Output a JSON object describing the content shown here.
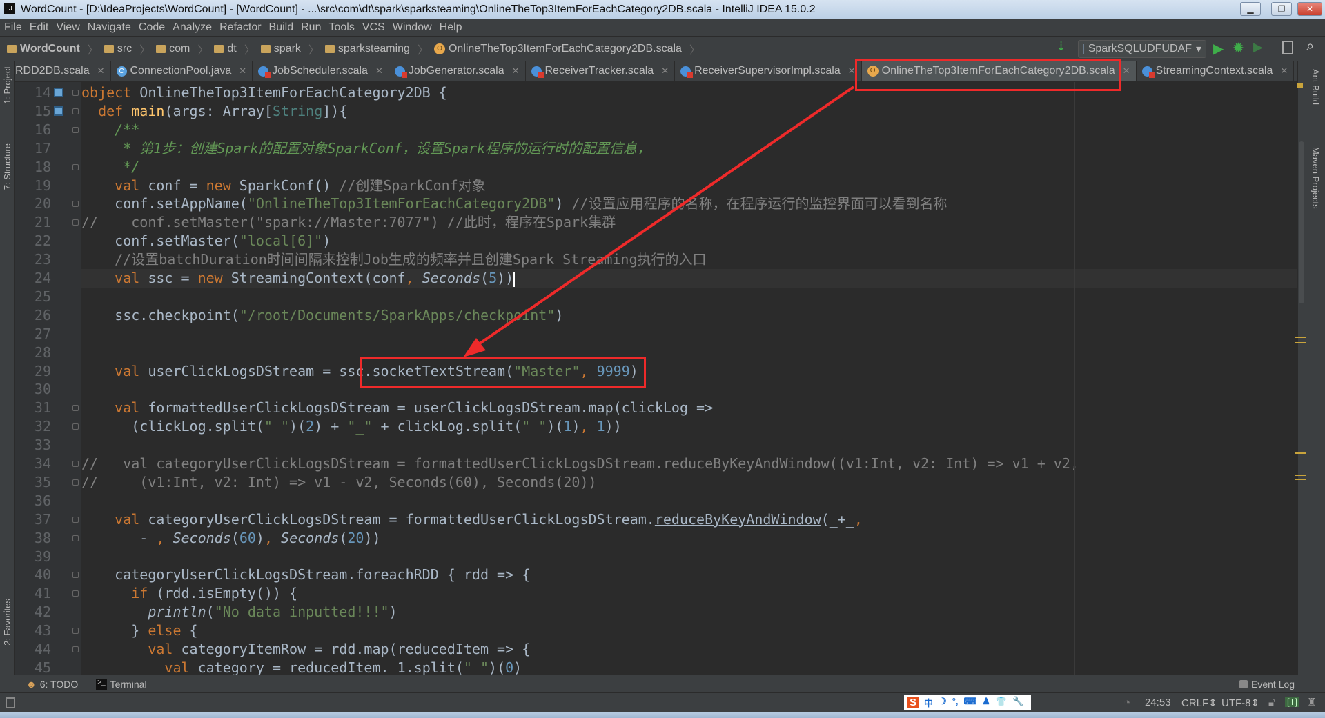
{
  "window": {
    "title": "WordCount - [D:\\IdeaProjects\\WordCount] - [WordCount] - ...\\src\\com\\dt\\spark\\sparksteaming\\OnlineTheTop3ItemForEachCategory2DB.scala - IntelliJ IDEA 15.0.2",
    "logo": "IJ"
  },
  "menu": [
    "File",
    "Edit",
    "View",
    "Navigate",
    "Code",
    "Analyze",
    "Refactor",
    "Build",
    "Run",
    "Tools",
    "VCS",
    "Window",
    "Help"
  ],
  "breadcrumb": [
    "WordCount",
    "src",
    "com",
    "dt",
    "spark",
    "sparksteaming",
    "OnlineTheTop3ItemForEachCategory2DB.scala"
  ],
  "toolbar": {
    "run_config": "SparkSQLUDFUDAF"
  },
  "tabs": [
    {
      "label": "RDD2DB.scala",
      "icon": "scala-class-icon"
    },
    {
      "label": "ConnectionPool.java",
      "icon": "java-class-icon"
    },
    {
      "label": "JobScheduler.scala",
      "icon": "scala-class-icon"
    },
    {
      "label": "JobGenerator.scala",
      "icon": "scala-class-icon"
    },
    {
      "label": "ReceiverTracker.scala",
      "icon": "scala-class-icon"
    },
    {
      "label": "ReceiverSupervisorImpl.scala",
      "icon": "scala-class-icon"
    },
    {
      "label": "OnlineTheTop3ItemForEachCategory2DB.scala",
      "icon": "scala-object-icon",
      "active": true
    },
    {
      "label": "StreamingContext.scala",
      "icon": "scala-class-icon"
    }
  ],
  "left_tools": [
    "1: Project",
    "7: Structure",
    "2: Favorites"
  ],
  "right_tools": [
    "Ant Build",
    "Maven Projects"
  ],
  "code": {
    "current_line": 24,
    "lines": [
      {
        "n": 14,
        "tokens": [
          [
            "k",
            "object"
          ],
          [
            "t",
            " OnlineTheTop3ItemForEachCategory2DB {"
          ]
        ]
      },
      {
        "n": 15,
        "tokens": [
          [
            "t",
            "  "
          ],
          [
            "k",
            "def"
          ],
          [
            "fn",
            " main"
          ],
          [
            "t",
            "(args: Array["
          ],
          [
            "ty",
            "String"
          ],
          [
            "t",
            "]){"
          ]
        ]
      },
      {
        "n": 16,
        "tokens": [
          [
            "t",
            "    "
          ],
          [
            "dc",
            "/**"
          ]
        ]
      },
      {
        "n": 17,
        "tokens": [
          [
            "dc",
            "     * 第1步：创建Spark的配置对象SparkConf，设置Spark程序的运行时的配置信息，"
          ]
        ]
      },
      {
        "n": 18,
        "tokens": [
          [
            "dc",
            "     */"
          ]
        ]
      },
      {
        "n": 19,
        "tokens": [
          [
            "t",
            "    "
          ],
          [
            "k",
            "val"
          ],
          [
            "t",
            " conf = "
          ],
          [
            "k",
            "new"
          ],
          [
            "t",
            " SparkConf() "
          ],
          [
            "c",
            "//创建SparkConf对象"
          ]
        ]
      },
      {
        "n": 20,
        "tokens": [
          [
            "t",
            "    conf.setAppName("
          ],
          [
            "s",
            "\"OnlineTheTop3ItemForEachCategory2DB\""
          ],
          [
            "t",
            ") "
          ],
          [
            "c",
            "//设置应用程序的名称，在程序运行的监控界面可以看到名称"
          ]
        ]
      },
      {
        "n": 21,
        "tokens": [
          [
            "c",
            "//    conf.setMaster(\"spark://Master:7077\") //此时，程序在Spark集群"
          ]
        ]
      },
      {
        "n": 22,
        "tokens": [
          [
            "t",
            "    conf.setMaster("
          ],
          [
            "s",
            "\"local[6]\""
          ],
          [
            "t",
            ")"
          ]
        ]
      },
      {
        "n": 23,
        "tokens": [
          [
            "c",
            "    //设置batchDuration时间间隔来控制Job生成的频率并且创建Spark Streaming执行的入口"
          ]
        ]
      },
      {
        "n": 24,
        "tokens": [
          [
            "t",
            "    "
          ],
          [
            "k",
            "val"
          ],
          [
            "t",
            " ssc = "
          ],
          [
            "k",
            "new"
          ],
          [
            "t",
            " StreamingContext(conf"
          ],
          [
            "k",
            ","
          ],
          [
            "t",
            " "
          ],
          [
            "i",
            "Seconds"
          ],
          [
            "t",
            "("
          ],
          [
            "n",
            "5"
          ],
          [
            "t",
            "))"
          ]
        ]
      },
      {
        "n": 25,
        "tokens": []
      },
      {
        "n": 26,
        "tokens": [
          [
            "t",
            "    ssc.checkpoint("
          ],
          [
            "s",
            "\"/root/Documents/SparkApps/checkpoint\""
          ],
          [
            "t",
            ")"
          ]
        ]
      },
      {
        "n": 27,
        "tokens": []
      },
      {
        "n": 28,
        "tokens": []
      },
      {
        "n": 29,
        "tokens": [
          [
            "t",
            "    "
          ],
          [
            "k",
            "val"
          ],
          [
            "t",
            " userClickLogsDStream = ssc.socketTextStream("
          ],
          [
            "s",
            "\"Master\""
          ],
          [
            "k",
            ","
          ],
          [
            "t",
            " "
          ],
          [
            "n",
            "9999"
          ],
          [
            "t",
            ")"
          ]
        ]
      },
      {
        "n": 30,
        "tokens": []
      },
      {
        "n": 31,
        "tokens": [
          [
            "t",
            "    "
          ],
          [
            "k",
            "val"
          ],
          [
            "t",
            " formattedUserClickLogsDStream = userClickLogsDStream.map(clickLog =>"
          ]
        ]
      },
      {
        "n": 32,
        "tokens": [
          [
            "t",
            "      (clickLog.split("
          ],
          [
            "s",
            "\" \""
          ],
          [
            "t",
            ")("
          ],
          [
            "n",
            "2"
          ],
          [
            "t",
            ") + "
          ],
          [
            "s",
            "\"_\""
          ],
          [
            "t",
            " + clickLog.split("
          ],
          [
            "s",
            "\" \""
          ],
          [
            "t",
            ")("
          ],
          [
            "n",
            "1"
          ],
          [
            "t",
            ")"
          ],
          [
            "k",
            ","
          ],
          [
            "t",
            " "
          ],
          [
            "n",
            "1"
          ],
          [
            "t",
            "))"
          ]
        ]
      },
      {
        "n": 33,
        "tokens": []
      },
      {
        "n": 34,
        "tokens": [
          [
            "c",
            "//   val categoryUserClickLogsDStream = formattedUserClickLogsDStream.reduceByKeyAndWindow((v1:Int, v2: Int) => v1 + v2,"
          ]
        ]
      },
      {
        "n": 35,
        "tokens": [
          [
            "c",
            "//     (v1:Int, v2: Int) => v1 - v2, Seconds(60), Seconds(20))"
          ]
        ]
      },
      {
        "n": 36,
        "tokens": []
      },
      {
        "n": 37,
        "tokens": [
          [
            "t",
            "    "
          ],
          [
            "k",
            "val"
          ],
          [
            "t",
            " categoryUserClickLogsDStream = formattedUserClickLogsDStream."
          ],
          [
            "u",
            "reduceByKeyAndWindow"
          ],
          [
            "t",
            "(_+_"
          ],
          [
            "k",
            ","
          ]
        ]
      },
      {
        "n": 38,
        "tokens": [
          [
            "t",
            "      _-_"
          ],
          [
            "k",
            ","
          ],
          [
            "t",
            " "
          ],
          [
            "i",
            "Seconds"
          ],
          [
            "t",
            "("
          ],
          [
            "n",
            "60"
          ],
          [
            "t",
            ")"
          ],
          [
            "k",
            ","
          ],
          [
            "t",
            " "
          ],
          [
            "i",
            "Seconds"
          ],
          [
            "t",
            "("
          ],
          [
            "n",
            "20"
          ],
          [
            "t",
            "))"
          ]
        ]
      },
      {
        "n": 39,
        "tokens": []
      },
      {
        "n": 40,
        "tokens": [
          [
            "t",
            "    categoryUserClickLogsDStream.foreachRDD { rdd => {"
          ]
        ]
      },
      {
        "n": 41,
        "tokens": [
          [
            "t",
            "      "
          ],
          [
            "k",
            "if"
          ],
          [
            "t",
            " (rdd.isEmpty()) {"
          ]
        ]
      },
      {
        "n": 42,
        "tokens": [
          [
            "t",
            "        "
          ],
          [
            "i",
            "println"
          ],
          [
            "t",
            "("
          ],
          [
            "s",
            "\"No data inputted!!!\""
          ],
          [
            "t",
            ")"
          ]
        ]
      },
      {
        "n": 43,
        "tokens": [
          [
            "t",
            "      } "
          ],
          [
            "k",
            "else"
          ],
          [
            "t",
            " {"
          ]
        ]
      },
      {
        "n": 44,
        "tokens": [
          [
            "t",
            "        "
          ],
          [
            "k",
            "val"
          ],
          [
            "t",
            " categoryItemRow = rdd.map(reducedItem => {"
          ]
        ]
      },
      {
        "n": 45,
        "tokens": [
          [
            "t",
            "          "
          ],
          [
            "k",
            "val"
          ],
          [
            "t",
            " category = reducedItem._1.split("
          ],
          [
            "s",
            "\" \""
          ],
          [
            "t",
            ")("
          ],
          [
            "n",
            "0"
          ],
          [
            "t",
            ")"
          ]
        ]
      }
    ]
  },
  "bottom_tools": {
    "todo": "6: TODO",
    "terminal": "Terminal",
    "event_log": "Event Log"
  },
  "status": {
    "position": "24:53",
    "line_sep": "CRLF",
    "encoding": "UTF-8",
    "ime": [
      "中",
      "☽",
      "°,",
      "⌨",
      "♟",
      "👕",
      "🔧"
    ]
  },
  "colors": {
    "annotation": "#ee2a2a",
    "keyword": "#cc7832",
    "string": "#6a8759",
    "number": "#6897bb"
  }
}
